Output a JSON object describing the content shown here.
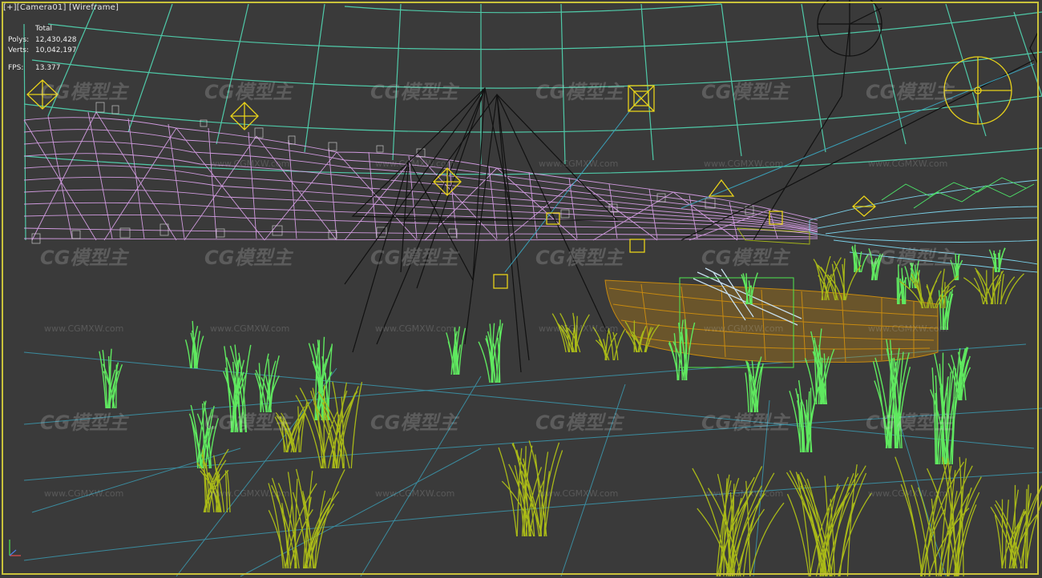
{
  "viewport": {
    "menu": "[+]",
    "camera": "[Camera01]",
    "shading": "[Wireframe]"
  },
  "stats": {
    "header": "Total",
    "polys_label": "Polys:",
    "polys": "12,430,428",
    "verts_label": "Verts:",
    "verts": "10,042,197",
    "fps_label": "FPS:",
    "fps": "13.377"
  },
  "watermark": {
    "logo": "CG模型主",
    "url": "www.CGMXW.com"
  },
  "colors": {
    "background": "#3a3a3a",
    "frame": "#c9c23a",
    "sky_grid": "#4fc9a8",
    "terrain": "#d9a0e8",
    "boat": "#c78a10",
    "grass_bright": "#5fe85f",
    "grass_dry": "#a8b818",
    "helpers": "#e8d21a",
    "camera_lines": "#111111",
    "water_lines": "#3aa0b8",
    "reeds_far": "#7ad0e8"
  },
  "icons": [
    "camera-target-icon",
    "light-helper-icon",
    "sun-helper-icon",
    "axis-gizmo-icon"
  ]
}
